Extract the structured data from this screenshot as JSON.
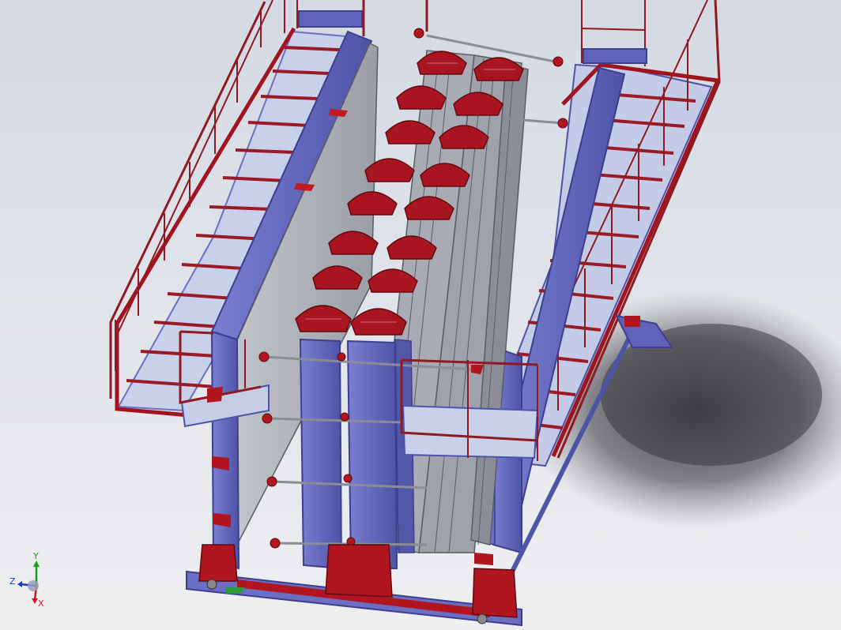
{
  "viewport": {
    "background_top": "#d4d9e2",
    "background_bottom": "#eeeff1"
  },
  "model": {
    "colors": {
      "frame_blue": "#6a6fc4",
      "frame_blue_dark": "#3d3f8e",
      "frame_blue_light": "#9a9ee0",
      "accent_red": "#b01520",
      "accent_red_dark": "#6e0a12",
      "panel_grey": "#b9bbc3",
      "panel_grey_dark": "#8a8c96",
      "glass": "#c9d2ec",
      "shadow": "#4a4a4e"
    }
  },
  "triad": {
    "x_label": "X",
    "y_label": "Y",
    "z_label": "Z",
    "x_color": "#d01818",
    "y_color": "#18a018",
    "z_color": "#1838d0"
  }
}
